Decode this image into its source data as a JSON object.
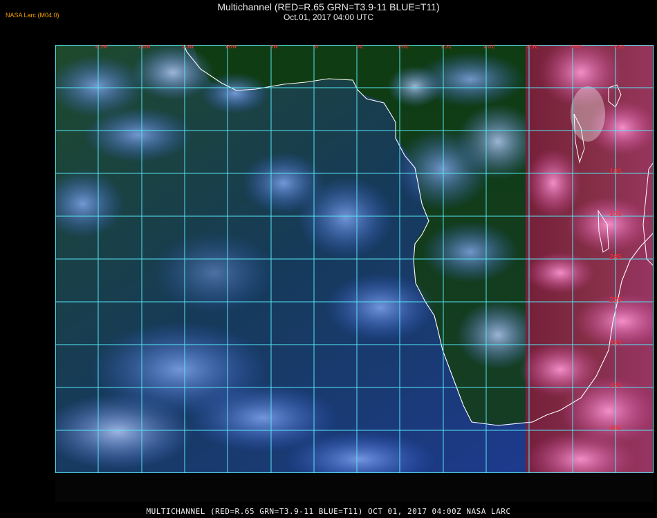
{
  "header": {
    "title": "Multichannel (RED=R.65 GRN=T3.9-11 BLUE=T11)",
    "subtitle": "Oct.01, 2017 04:00 UTC",
    "brand": "NASA Larc (M04.0)"
  },
  "map": {
    "lon_labels": [
      "25W",
      "20W",
      "15W",
      "10W",
      "5W",
      "0",
      "5E",
      "10E",
      "15E",
      "20E",
      "25E",
      "30E",
      "35E"
    ],
    "lat_labels": [
      "10S",
      "15S",
      "20S",
      "25S",
      "30S",
      "35S",
      "40S"
    ],
    "colors": {
      "grid": "#55e6f5",
      "coast": "#ffffff",
      "label": "#ff2a2a"
    }
  },
  "footer": {
    "text": "MULTICHANNEL (RED=R.65 GRN=T3.9-11 BLUE=T11) OCT 01, 2017 04:00Z   NASA LARC"
  }
}
